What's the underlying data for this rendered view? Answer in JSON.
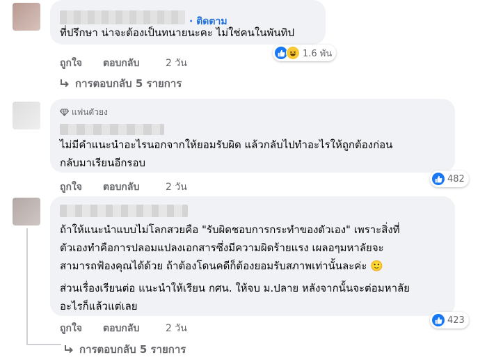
{
  "comments": [
    {
      "follow_label": "· ติดตาม",
      "lines": [
        "ที่ปรึกษา น่าจะต้องเป็นทนายนะคะ ไม่ใช่คนในพันทิป"
      ],
      "reaction_count": "1.6 พัน",
      "like_label": "ถูกใจ",
      "reply_label": "ตอบกลับ",
      "time": "2 วัน",
      "replies_label": "การตอบกลับ 5 รายการ"
    },
    {
      "fan_badge": "แฟนตัวยง",
      "lines": [
        "ไม่มีคำแนะนำอะไรนอกจากให้ยอมรับผิด แล้วกลับไปทำอะไรให้ถูกต้องก่อน",
        "กลับมาเรียนอีกรอบ"
      ],
      "reaction_count": "482",
      "like_label": "ถูกใจ",
      "reply_label": "ตอบกลับ",
      "time": "2 วัน"
    },
    {
      "lines": [
        "ถ้าให้แนะนำแบบไม่โลกสวยคือ \"รับผิดชอบการกระทำของตัวเอง\" เพราะสิ่งที่",
        "ตัวเองทำคือการปลอมแปลงเอกสารซึ่งมีความผิดร้ายแรง เผลอๆมหาลัยจะ",
        "สามารถฟ้องคุณได้ด้วย ถ้าต้องโดนคดีก็ต้องยอมรับสภาพเท่านั้นละค่ะ 🙂",
        "ส่วนเรื่องเรียนต่อ แนะนำให้เรียน กศน. ให้จบ ม.ปลาย หลังจากนั้นจะต่อมหาลัย",
        "อะไรก็แล้วแต่เลย"
      ],
      "reaction_count": "423",
      "like_label": "ถูกใจ",
      "reply_label": "ตอบกลับ",
      "time": "2 วัน",
      "replies_label": "การตอบกลับ 5 รายการ"
    }
  ],
  "colors": {
    "bubble": "#f0f2f5",
    "link_blue": "#216fdb",
    "like_blue": "#1877f2",
    "secondary_text": "#65676b"
  },
  "icons": [
    "like-icon",
    "haha-icon",
    "reply-arrow-icon",
    "diamond-icon",
    "smile-emoji"
  ]
}
